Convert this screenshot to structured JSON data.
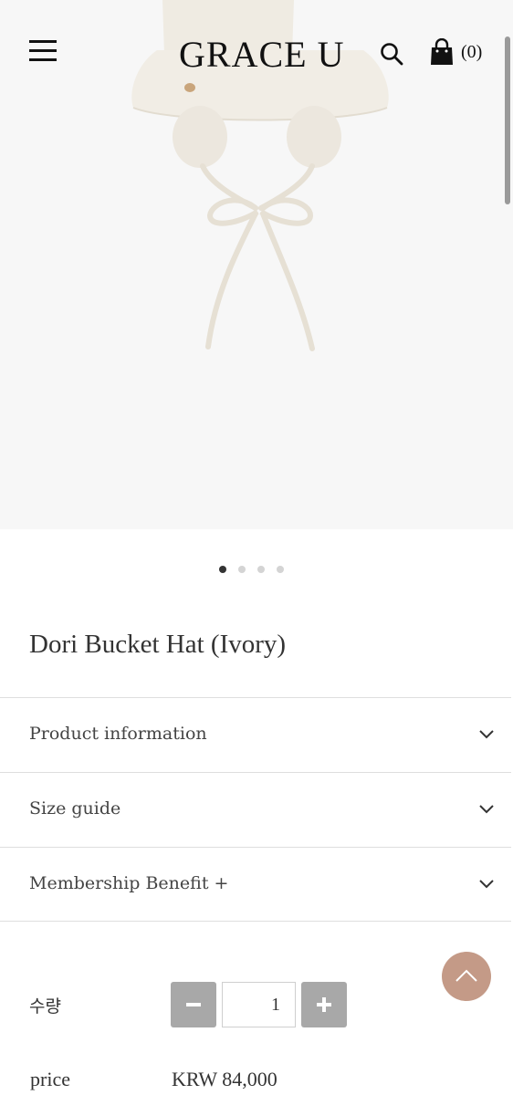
{
  "header": {
    "logo": "GRACE U",
    "cart_count": "(0)",
    "icons": [
      "menu-icon",
      "search-icon",
      "shopping-bag-icon"
    ]
  },
  "gallery": {
    "image_subject": "ivory bucket hat with ear flaps and tie strings",
    "slide_count": 4,
    "active_slide": 1
  },
  "product": {
    "title": "Dori Bucket Hat (Ivory)"
  },
  "accordion": [
    {
      "label": "Product information"
    },
    {
      "label": "Size guide"
    },
    {
      "label": "Membership Benefit +"
    }
  ],
  "quantity": {
    "label": "수량",
    "value": "1"
  },
  "price": {
    "label": "price",
    "value": "KRW 84,000"
  },
  "colors": {
    "accent": "#c49a87",
    "stepper": "#a8a8a8",
    "hero_bg": "#f7f7f7"
  }
}
